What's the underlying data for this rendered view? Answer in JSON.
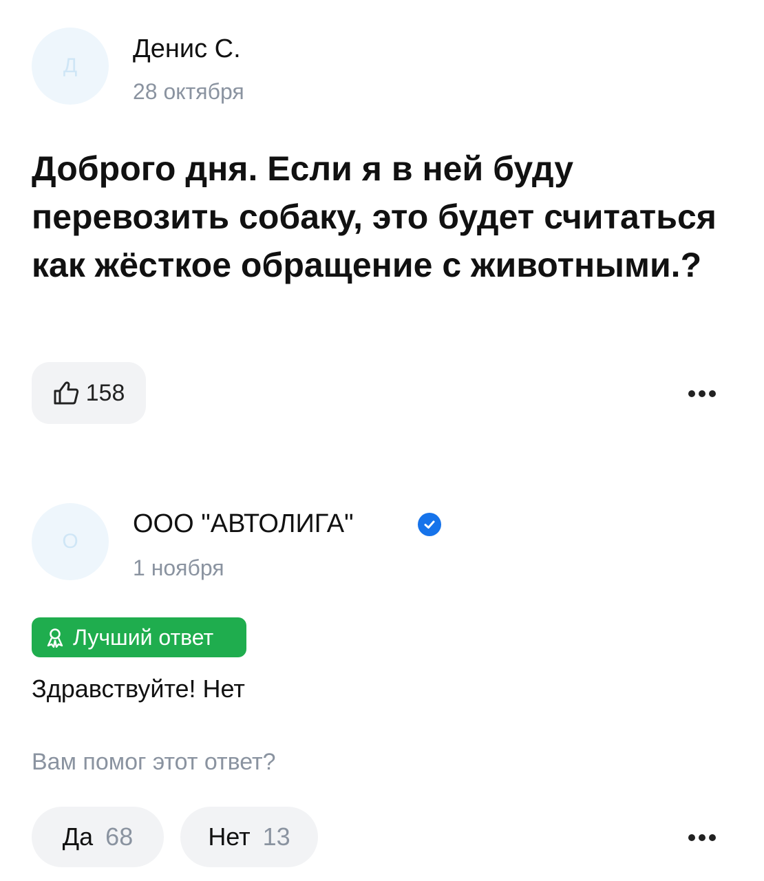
{
  "question": {
    "author": {
      "initial": "Д",
      "name": "Денис С.",
      "date": "28 октября"
    },
    "text": "Доброго дня. Если я в ней буду перевозить собаку, это будет считаться как жёсткое обращение с животными.?",
    "likes": "158",
    "icons": {
      "like": "thumbs-up-icon",
      "more": "more-dots-icon"
    }
  },
  "answer": {
    "author": {
      "initial": "О",
      "name": "ООО \"АВТОЛИГА\"",
      "date": "1 ноября",
      "verified": true
    },
    "badge": "Лучший ответ",
    "text": "Здравствуйте! Нет",
    "helpful_question": "Вам помог этот ответ?",
    "votes": {
      "yes": {
        "label": "Да",
        "count": "68"
      },
      "no": {
        "label": "Нет",
        "count": "13"
      }
    },
    "icons": {
      "badge": "award-ribbon-icon",
      "verified": "verified-check-icon",
      "more": "more-dots-icon"
    }
  },
  "colors": {
    "accent_green": "#1fad4e",
    "verified_blue": "#1673ea",
    "muted_text": "#8a93a0",
    "button_bg": "#f2f3f5",
    "avatar_bg": "#eef6fc"
  }
}
